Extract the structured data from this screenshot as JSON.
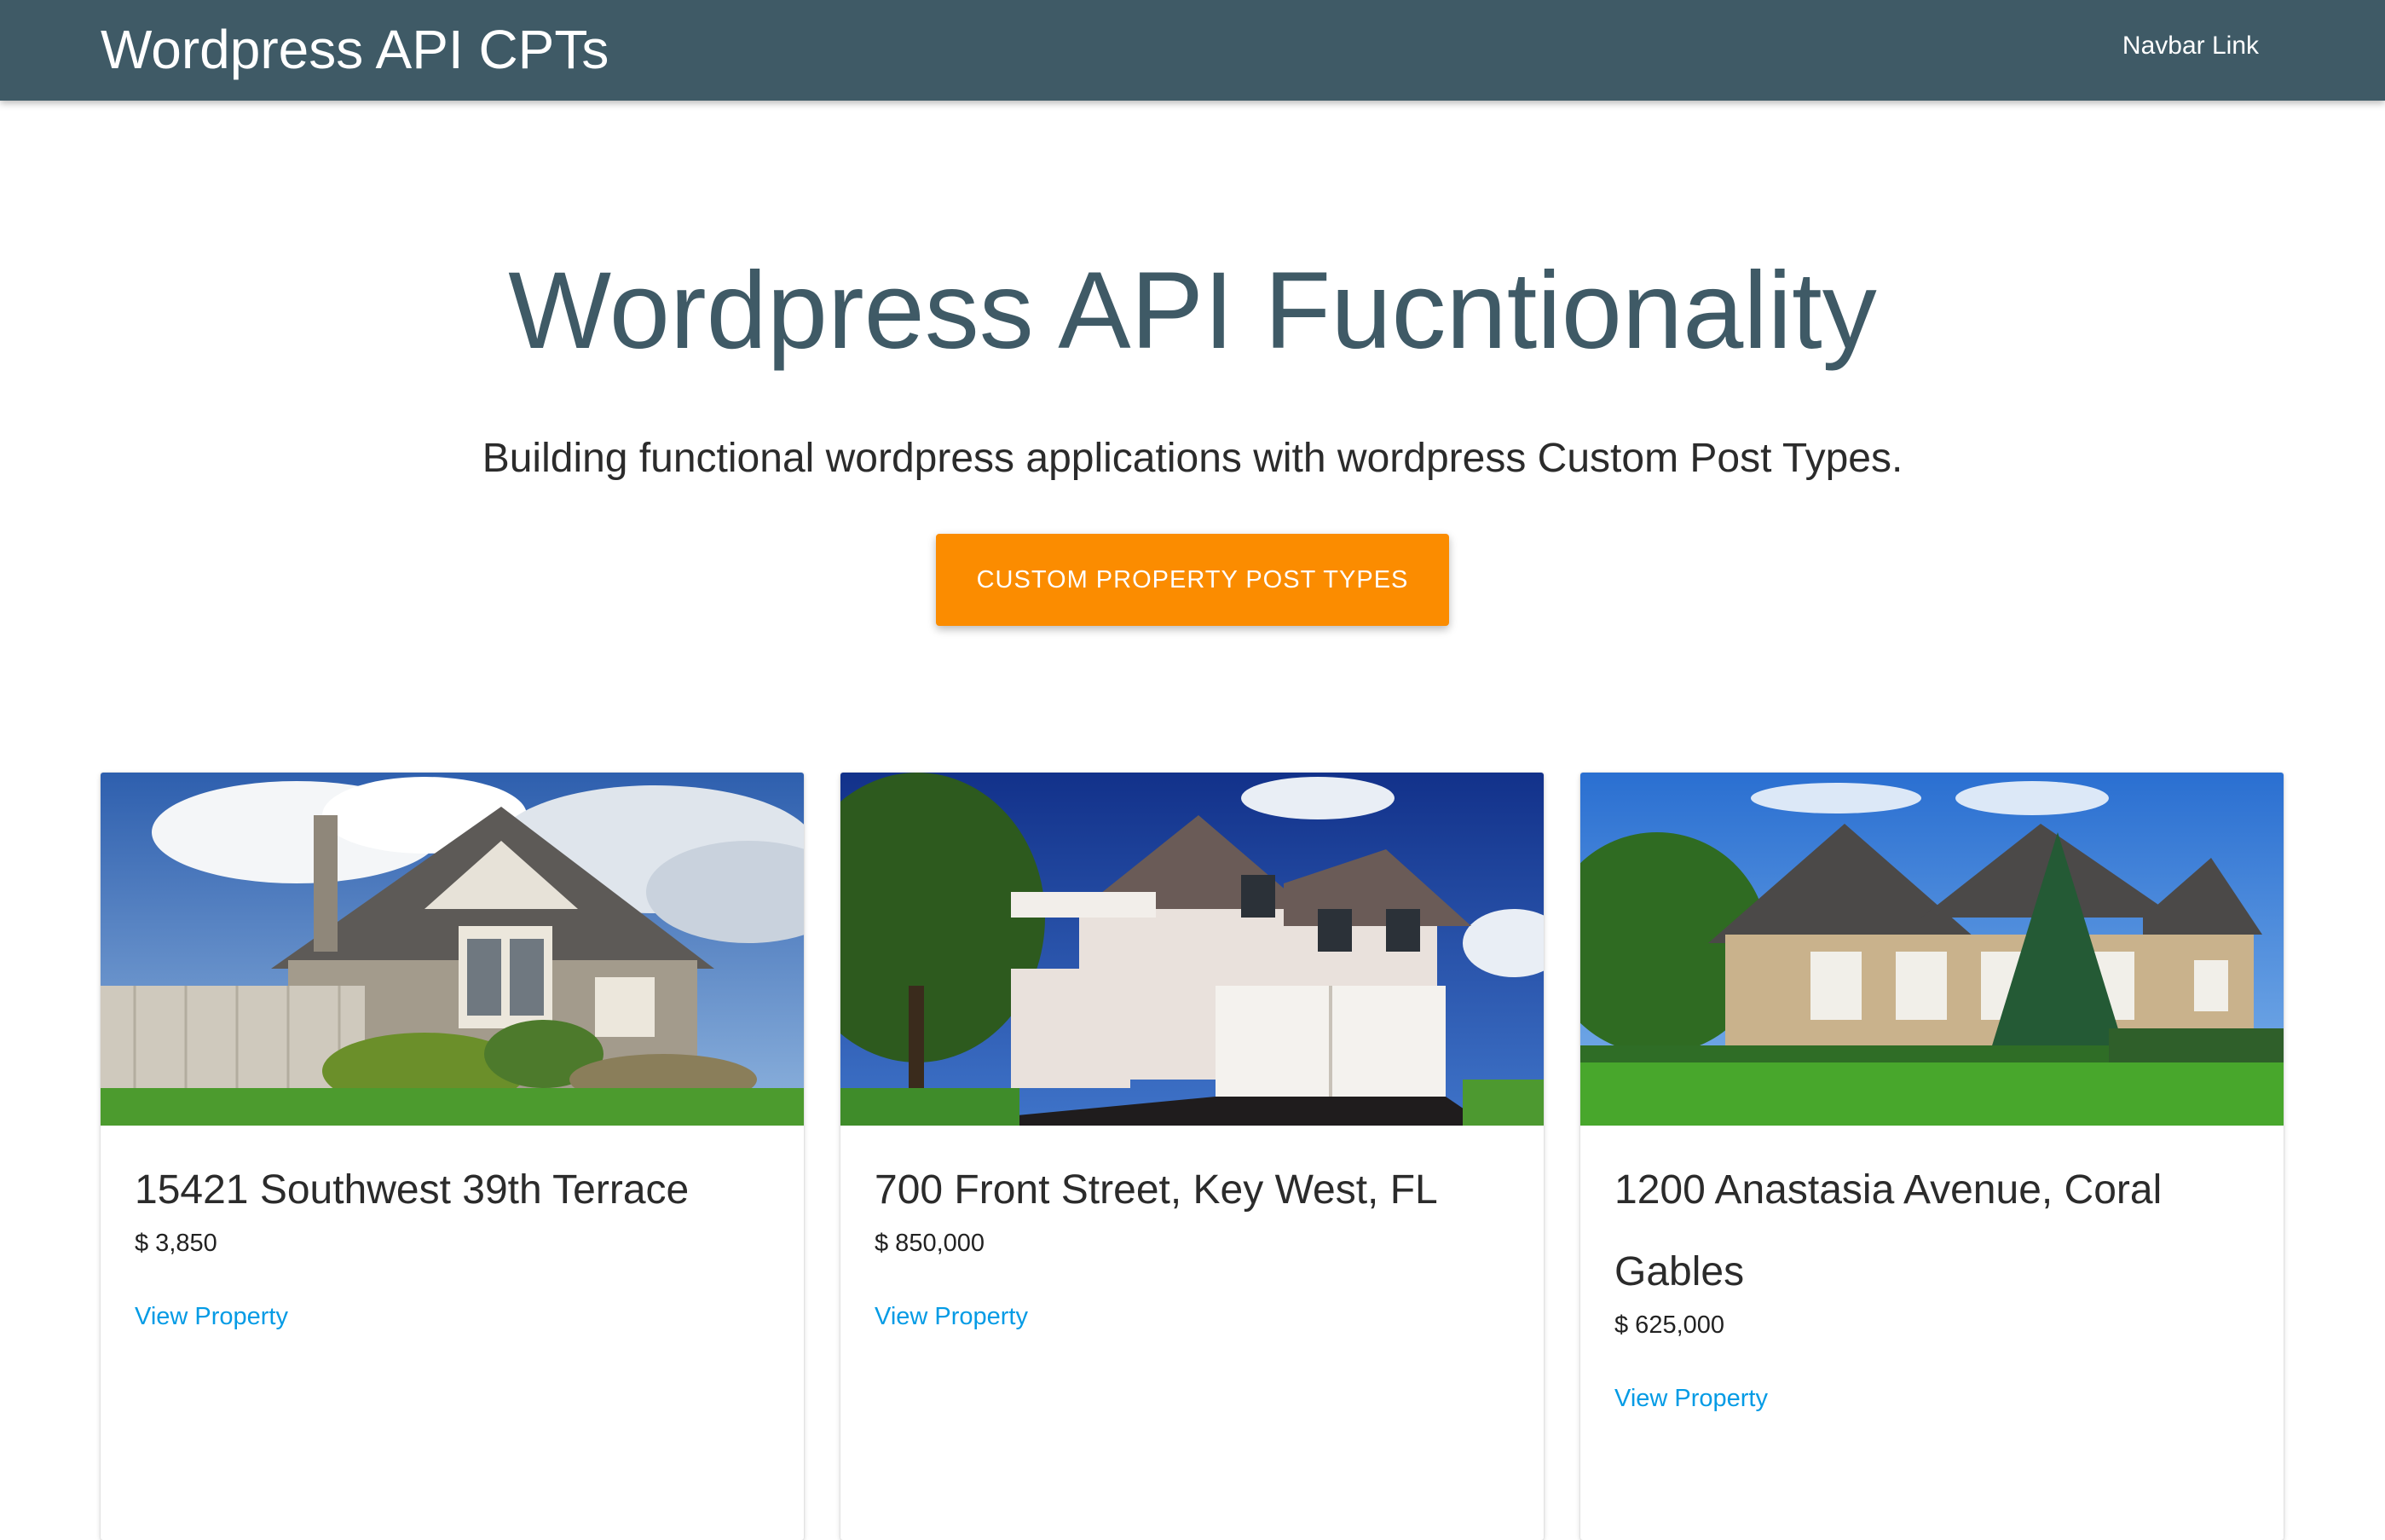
{
  "navbar": {
    "brand": "Wordpress API CPTs",
    "link": "Navbar Link",
    "color": "#3f5a66"
  },
  "hero": {
    "title": "Wordpress API Fucntionality",
    "subtitle": "Building functional wordpress applications with wordpress Custom Post Types.",
    "cta_label": "CUSTOM PROPERTY POST TYPES",
    "cta_color": "#fb8c00"
  },
  "properties": [
    {
      "title": "15421 Southwest 39th Terrace",
      "price": "$ 3,850",
      "link": "View Property",
      "image": "house-photo-gray-siding"
    },
    {
      "title": "700 Front Street, Key West, FL",
      "price": "$ 850,000",
      "link": "View Property",
      "image": "house-photo-white-two-story"
    },
    {
      "title": "1200 Anastasia Avenue, Coral Gables",
      "price": "$ 625,000",
      "link": "View Property",
      "image": "house-photo-brick-estate"
    }
  ],
  "link_color": "#039be5"
}
